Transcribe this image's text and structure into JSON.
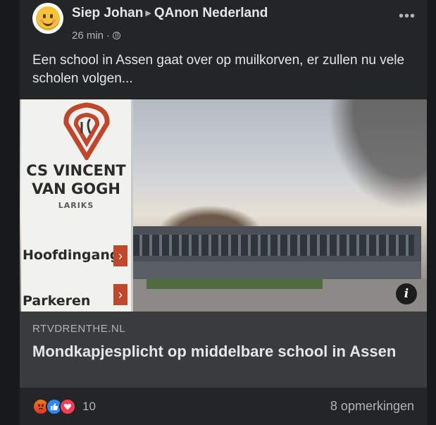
{
  "post": {
    "author": "Siep Johan",
    "group": "QAnon Nederland",
    "time": "26 min",
    "separator": "·",
    "more_label": "•••",
    "text": "Een school in Assen gaat over op muilkorven, er zullen nu vele scholen volgen..."
  },
  "link": {
    "domain": "RTVDRENTHE.NL",
    "title": "Mondkapjesplicht op middelbare school in Assen",
    "info_label": "i",
    "image": {
      "sign_title_line1": "CS VINCENT",
      "sign_title_line2": "VAN GOGH",
      "sign_subtitle": "LARIKS",
      "sign_row1": "Hoofdingang",
      "sign_row2": "Parkeren",
      "arrow": "›"
    }
  },
  "footer": {
    "reactions": [
      "angry-icon",
      "like-icon",
      "love-icon"
    ],
    "reaction_count": "10",
    "comments": "8 opmerkingen"
  },
  "colors": {
    "background": "#18191a",
    "card": "#242526",
    "link_meta": "#3a3b3c",
    "text_primary": "#e4e6eb",
    "text_secondary": "#b0b3b8",
    "accent_like": "#2d88ff",
    "accent_love": "#f33e58"
  }
}
